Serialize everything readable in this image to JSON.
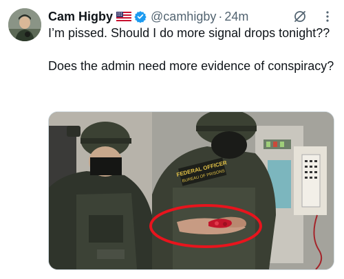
{
  "author": {
    "name": "Cam Higby",
    "handle": "@camhigby",
    "separator": "·",
    "timestamp": "24m"
  },
  "tweet": {
    "paragraphs": [
      "I’m pissed. Should I do more signal drops tonight??",
      "Does the admin need more evidence of conspiracy?"
    ]
  },
  "media": {
    "patch_line1": "FEDERAL OFFICER",
    "patch_line2": "BUREAU OF PRISONS"
  },
  "icons": {
    "flag": "us-flag-icon",
    "verified": "verified-badge-icon",
    "grok": "grok-icon",
    "more": "more-options-icon"
  },
  "colors": {
    "verified_blue": "#1d9bf0",
    "secondary_text": "#536471",
    "highlight_circle": "#e8141d"
  }
}
